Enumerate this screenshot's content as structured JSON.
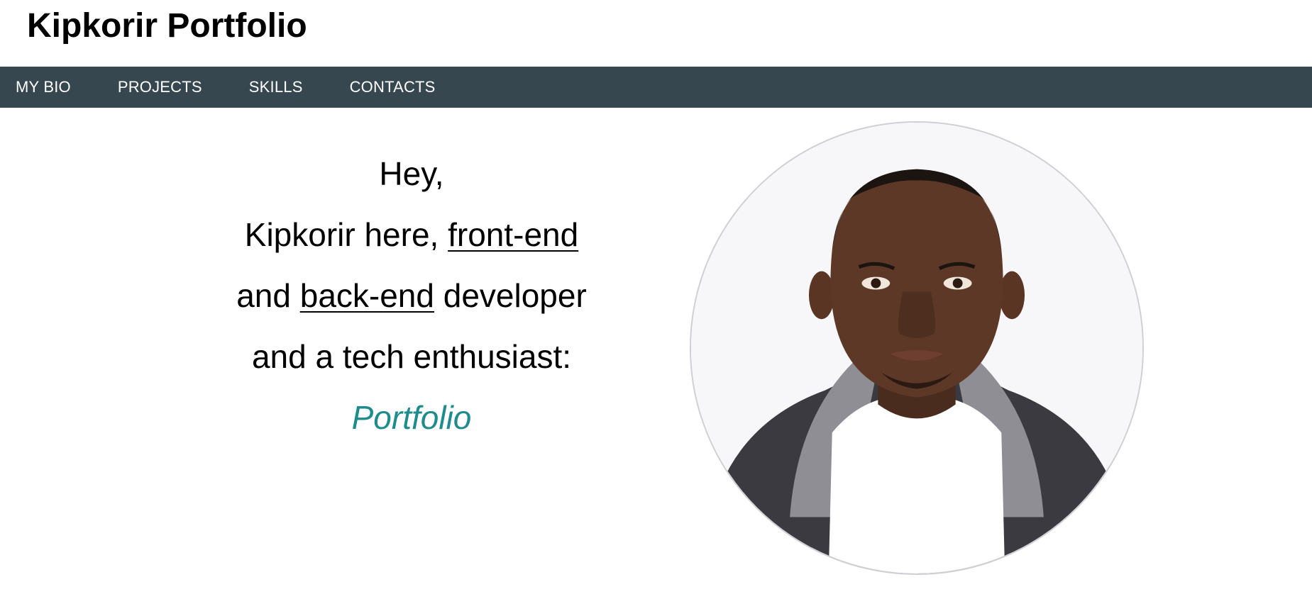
{
  "header": {
    "title": "Kipkorir Portfolio"
  },
  "nav": {
    "items": [
      {
        "label": "MY BIO"
      },
      {
        "label": "PROJECTS"
      },
      {
        "label": "SKILLS"
      },
      {
        "label": "CONTACTS"
      }
    ]
  },
  "intro": {
    "greeting": "Hey,",
    "line2_prefix": "Kipkorir here, ",
    "line2_link": "front-end",
    "line3_prefix": "and ",
    "line3_link": "back-end",
    "line3_suffix": " developer",
    "line4": "and a tech enthusiast:",
    "portfolio_link": "Portfolio"
  },
  "colors": {
    "nav_bg": "#37474f",
    "accent": "#1e8c8c"
  },
  "avatar": {
    "icon": "profile-photo"
  }
}
